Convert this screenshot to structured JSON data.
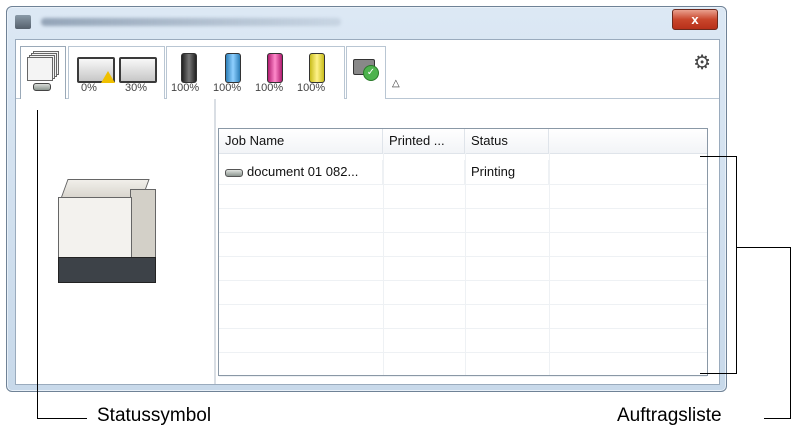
{
  "window": {
    "title": "",
    "close_label": "x"
  },
  "toolbar": {
    "tray_levels": [
      "0%",
      "30%"
    ],
    "toner_levels": [
      "100%",
      "100%",
      "100%",
      "100%"
    ]
  },
  "job_list": {
    "columns": [
      "Job Name",
      "Printed ...",
      "Status"
    ],
    "rows": [
      {
        "job_name": "document 01 082...",
        "printed": "",
        "status": "Printing"
      }
    ]
  },
  "annotations": {
    "status_symbol": "Statussymbol",
    "job_list": "Auftragsliste"
  },
  "colors": {
    "toner_black": "#222222",
    "toner_cyan": "#2d7fb8",
    "toner_magenta": "#b01c70",
    "toner_yellow": "#c8bc1b",
    "close_button": "#c9462c"
  }
}
